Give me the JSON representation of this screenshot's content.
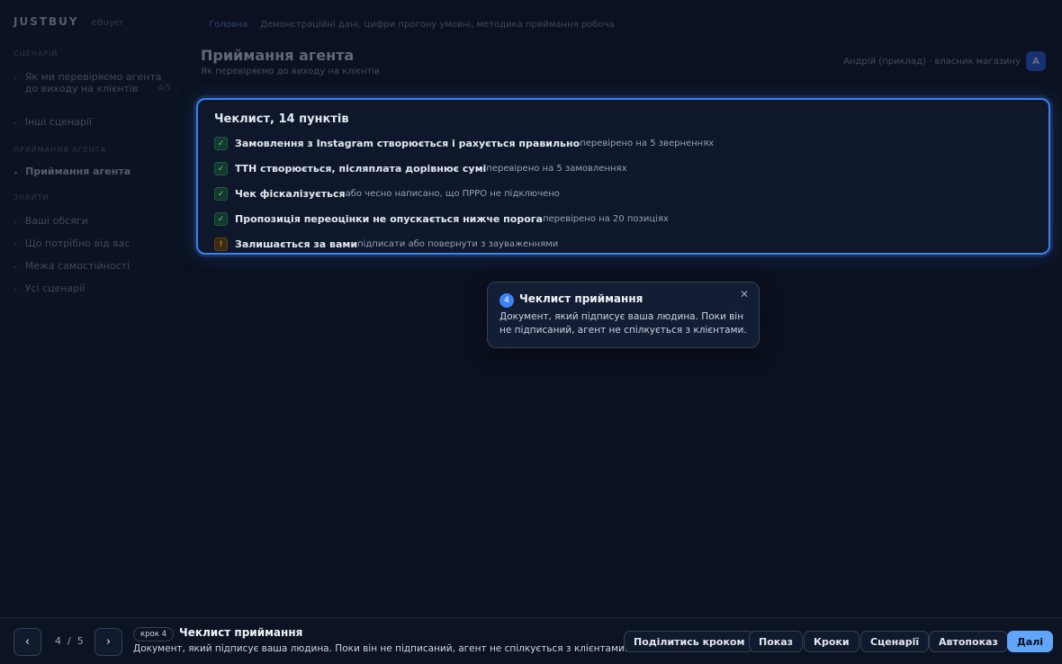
{
  "brand": {
    "logo": "JUSTBUY",
    "tag": "eBuyer"
  },
  "sidebar": {
    "section_1": "Сценарій",
    "items_1": [
      {
        "label": "Як ми перевіряємо агента до виходу на клієнтів",
        "count": "4/5"
      },
      {
        "label": "Інші сценарії"
      }
    ],
    "section_2": "Приймання агента",
    "active_item": "Приймання агента",
    "section_3": "Знайти",
    "items_3": [
      {
        "label": "Ваші обсяги"
      },
      {
        "label": "Що потрібно від вас"
      },
      {
        "label": "Межа самостійності"
      },
      {
        "label": "Усі сценарії"
      }
    ]
  },
  "header": {
    "crumb_link": "Головна",
    "crumb_text": "Демонстраційні дані, цифри прогону умовні, методика приймання робоча",
    "title": "Приймання агента",
    "subtitle": "Як перевіряємо до виходу на клієнтів",
    "user_name": "Андрій (приклад) · власник магазину",
    "avatar": "А"
  },
  "checklist": {
    "title": "Чеклист, 14 пунктів",
    "items": [
      {
        "status": "ok",
        "icon": "check-icon",
        "symbol": "✓",
        "main": "Замовлення з Instagram створюється і рахується правильно",
        "note": "перевірено на 5 зверненнях"
      },
      {
        "status": "ok",
        "icon": "check-icon",
        "symbol": "✓",
        "main": "ТТН створюється, післяплата дорівнює сумі",
        "note": "перевірено на 5 замовленнях"
      },
      {
        "status": "ok",
        "icon": "check-icon",
        "symbol": "✓",
        "main": "Чек фіскалізується",
        "note": "або чесно написано, що ПРРО не підключено"
      },
      {
        "status": "ok",
        "icon": "check-icon",
        "symbol": "✓",
        "main": "Пропозиція переоцінки не опускається нижче порога",
        "note": "перевірено на 20 позиціях"
      },
      {
        "status": "warn",
        "icon": "exclamation-icon",
        "symbol": "!",
        "main": "Залишається за вами",
        "note": "підписати або повернути з зауваженнями"
      }
    ]
  },
  "popover": {
    "step_number": "4",
    "title": "Чеклист приймання",
    "body": "Документ, який підписує ваша людина. Поки він не підписаний, агент не спілкується з клієнтами.",
    "close_symbol": "✕"
  },
  "tour": {
    "prev_symbol": "‹",
    "next_symbol": "›",
    "current": "4",
    "separator": "/",
    "total": "5",
    "badge": "крок 4",
    "title": "Чеклист приймання",
    "description": "Документ, який підписує ваша людина. Поки він не підписаний, агент не спілкується з клієнтами.",
    "buttons": {
      "share": "Поділитись кроком",
      "show": "Показ",
      "steps": "Кроки",
      "scenarios": "Сценарії",
      "autoplay": "Автопоказ",
      "next": "Далі"
    }
  },
  "colors": {
    "accent": "#3b82f6",
    "primary_button": "#60a5fa",
    "ok": "#4ade80",
    "warn": "#fbbf24",
    "background": "#0b1120"
  }
}
